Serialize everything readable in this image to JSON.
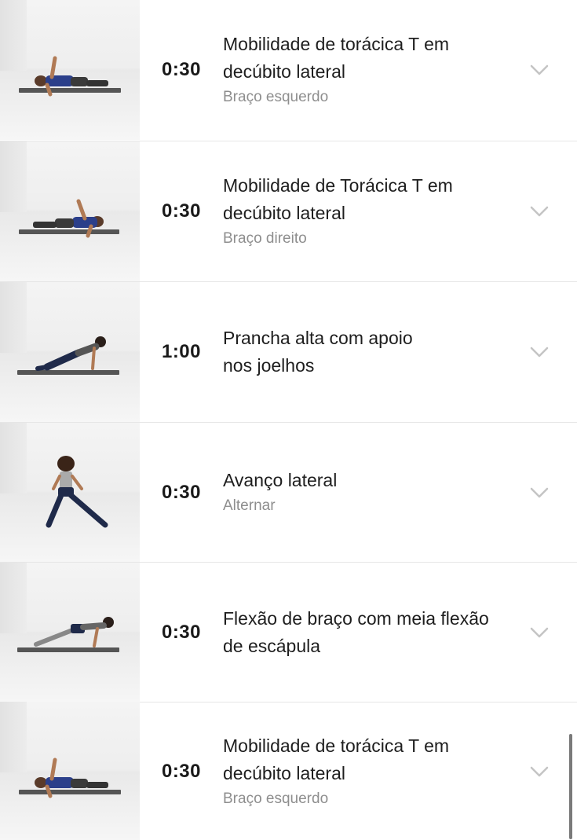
{
  "exercises": [
    {
      "duration": "0:30",
      "title_line1": "Mobilidade de torácica T em",
      "title_line2": "decúbito lateral",
      "subtitle": "Braço esquerdo"
    },
    {
      "duration": "0:30",
      "title_line1": "Mobilidade de Torácica T em",
      "title_line2": "decúbito lateral",
      "subtitle": "Braço direito"
    },
    {
      "duration": "1:00",
      "title_line1": "Prancha alta com apoio",
      "title_line2": "nos joelhos",
      "subtitle": ""
    },
    {
      "duration": "0:30",
      "title_line1": "Avanço lateral",
      "title_line2": "",
      "subtitle": "Alternar"
    },
    {
      "duration": "0:30",
      "title_line1": "Flexão de braço com meia flexão",
      "title_line2": "de escápula",
      "subtitle": ""
    },
    {
      "duration": "0:30",
      "title_line1": "Mobilidade de torácica T em",
      "title_line2": "decúbito lateral",
      "subtitle": "Braço esquerdo"
    }
  ],
  "icons": {
    "expand": "chevron-down-icon"
  },
  "colors": {
    "title": "#1e1e1e",
    "subtitle": "#8e8e8e",
    "divider": "#e6e6e6",
    "chevron": "#c4c4c4"
  }
}
